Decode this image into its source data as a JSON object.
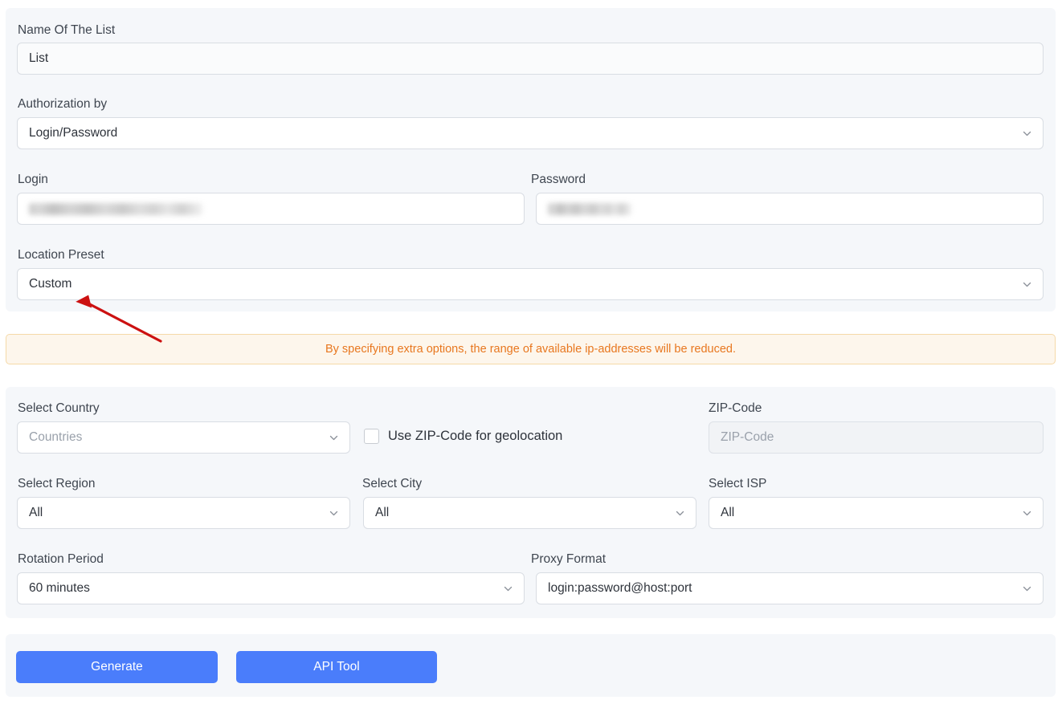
{
  "form": {
    "list_name": {
      "label": "Name Of The List",
      "value": "List"
    },
    "authorization": {
      "label": "Authorization by",
      "value": "Login/Password",
      "icon": "chevron-down-icon"
    },
    "login": {
      "label": "Login",
      "value": ""
    },
    "password": {
      "label": "Password",
      "value": ""
    },
    "location_preset": {
      "label": "Location Preset",
      "value": "Custom",
      "icon": "chevron-down-icon"
    }
  },
  "banner": {
    "text": "By specifying extra options, the range of available ip-addresses will be reduced.",
    "text_color": "#e8771f",
    "background_color": "#fdf6ec",
    "border_color": "#f5d9a8"
  },
  "options": {
    "country": {
      "label": "Select Country",
      "placeholder": "Countries",
      "value": "",
      "icon": "chevron-down-icon"
    },
    "zip_checkbox": {
      "label": "Use ZIP-Code for geolocation",
      "checked": false
    },
    "zip_code": {
      "label": "ZIP-Code",
      "placeholder": "ZIP-Code",
      "value": "",
      "disabled": true
    },
    "region": {
      "label": "Select Region",
      "value": "All",
      "icon": "chevron-down-icon"
    },
    "city": {
      "label": "Select City",
      "value": "All",
      "icon": "chevron-down-icon"
    },
    "isp": {
      "label": "Select ISP",
      "value": "All",
      "icon": "chevron-down-icon"
    },
    "rotation_period": {
      "label": "Rotation Period",
      "value": "60 minutes",
      "icon": "chevron-down-icon"
    },
    "proxy_format": {
      "label": "Proxy Format",
      "value": "login:password@host:port",
      "icon": "chevron-down-icon"
    }
  },
  "actions": {
    "generate": "Generate",
    "api_tool": "API Tool",
    "button_color": "#4a7dfb"
  },
  "annotation": {
    "type": "arrow",
    "color": "#cc1111",
    "points_at": "location-preset-select"
  }
}
